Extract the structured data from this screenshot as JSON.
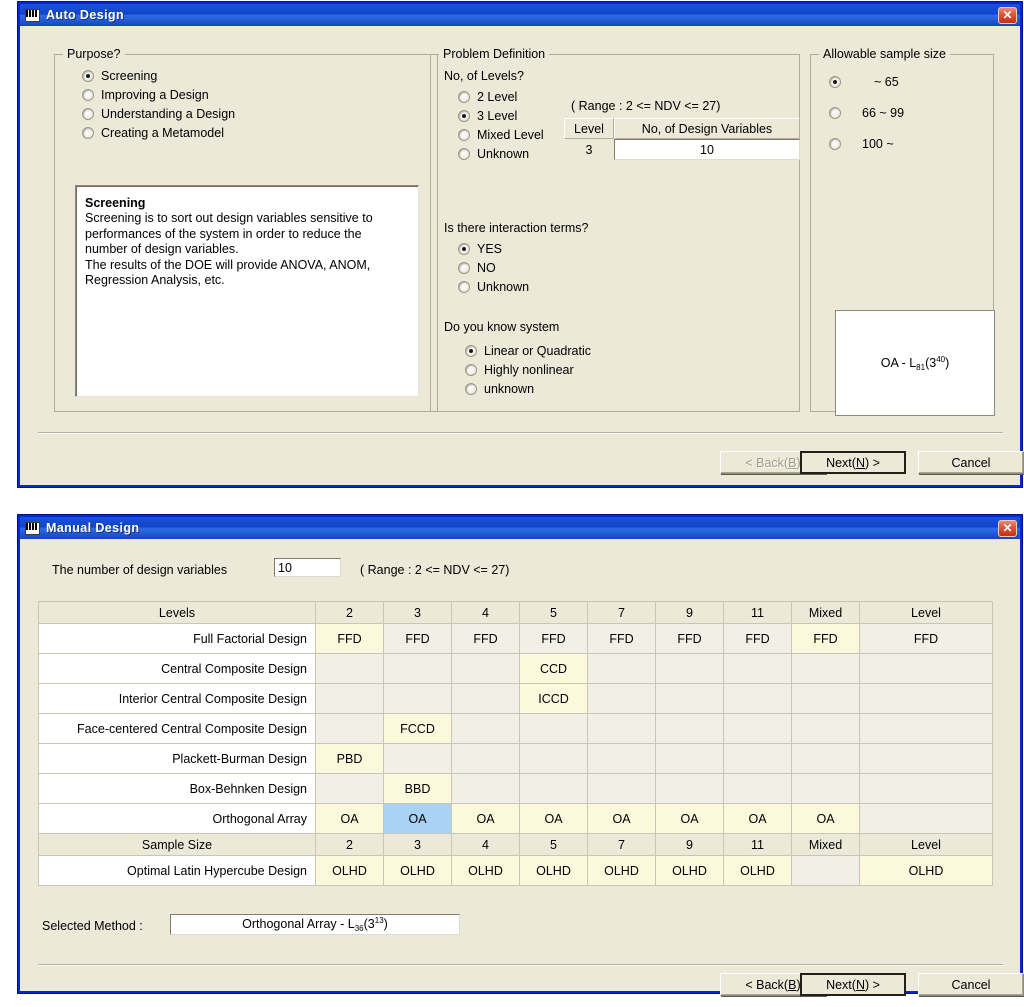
{
  "auto_design": {
    "title": "Auto Design",
    "close_label": "✕",
    "purpose": {
      "legend": "Purpose?",
      "options": [
        {
          "label": "Screening",
          "selected": true
        },
        {
          "label": "Improving a Design",
          "selected": false
        },
        {
          "label": "Understanding a Design",
          "selected": false
        },
        {
          "label": "Creating a Metamodel",
          "selected": false
        }
      ],
      "description_title": "Screening",
      "description_lines": [
        "Screening is to sort out design variables sensitive to",
        "performances of the system in order to reduce the",
        "number of design variables.",
        "The results of the DOE will provide ANOVA, ANOM,",
        "Regression Analysis, etc."
      ]
    },
    "problem_definition": {
      "legend": "Problem Definition",
      "levels_label": "No, of Levels?",
      "level_options": [
        {
          "label": "2 Level",
          "selected": false
        },
        {
          "label": "3 Level",
          "selected": true
        },
        {
          "label": "Mixed Level",
          "selected": false
        },
        {
          "label": "Unknown",
          "selected": false
        }
      ],
      "range_note": "( Range : 2 <= NDV <= 27)",
      "level_col_header": "Level",
      "ndv_col_header": "No, of Design Variables",
      "level_value": "3",
      "ndv_value": "10",
      "interaction_label": "Is there interaction terms?",
      "interaction_options": [
        {
          "label": "YES",
          "selected": true
        },
        {
          "label": "NO",
          "selected": false
        },
        {
          "label": "Unknown",
          "selected": false
        }
      ],
      "system_label": "Do you know system",
      "system_options": [
        {
          "label": "Linear or Quadratic",
          "selected": true
        },
        {
          "label": "Highly nonlinear",
          "selected": false
        },
        {
          "label": "unknown",
          "selected": false
        }
      ]
    },
    "sample_size": {
      "legend": "Allowable sample size",
      "options": [
        {
          "label": "~ 65",
          "selected": true
        },
        {
          "label": "66 ~ 99",
          "selected": false
        },
        {
          "label": "100 ~",
          "selected": false
        }
      ],
      "result_prefix": "OA - L",
      "result_sub": "81",
      "result_mid": "(3",
      "result_sup": "40",
      "result_suffix": ")"
    },
    "buttons": {
      "back": "< Back(B)",
      "back_pre": "< Back(",
      "back_key": "B",
      "back_post": ")",
      "next_pre": "Next(",
      "next_key": "N",
      "next_post": ") >",
      "cancel": "Cancel"
    }
  },
  "manual_design": {
    "title": "Manual Design",
    "close_label": "✕",
    "ndv_label": "The number of design variables",
    "ndv_value": "10",
    "range_note": "( Range : 2 <= NDV <= 27)",
    "table": {
      "corner_header": "Levels",
      "columns": [
        "2",
        "3",
        "4",
        "5",
        "7",
        "9",
        "11",
        "Mixed",
        "Level"
      ],
      "midheader": {
        "label": "Sample Size",
        "columns": [
          "2",
          "3",
          "4",
          "5",
          "7",
          "9",
          "11",
          "Mixed",
          "Level"
        ]
      },
      "rows": [
        {
          "label": "Full Factorial Design",
          "cells": [
            "FFD",
            "FFD",
            "FFD",
            "FFD",
            "FFD",
            "FFD",
            "FFD",
            "FFD",
            "FFD"
          ],
          "hi": [
            true,
            false,
            false,
            false,
            false,
            false,
            false,
            true,
            false
          ],
          "sel": [
            false,
            false,
            false,
            false,
            false,
            false,
            false,
            false,
            false
          ]
        },
        {
          "label": "Central Composite Design",
          "cells": [
            "",
            "",
            "",
            "CCD",
            "",
            "",
            "",
            "",
            ""
          ],
          "hi": [
            false,
            false,
            false,
            true,
            false,
            false,
            false,
            false,
            false
          ],
          "sel": [
            false,
            false,
            false,
            false,
            false,
            false,
            false,
            false,
            false
          ]
        },
        {
          "label": "Interior Central Composite Design",
          "cells": [
            "",
            "",
            "",
            "ICCD",
            "",
            "",
            "",
            "",
            ""
          ],
          "hi": [
            false,
            false,
            false,
            true,
            false,
            false,
            false,
            false,
            false
          ],
          "sel": [
            false,
            false,
            false,
            false,
            false,
            false,
            false,
            false,
            false
          ]
        },
        {
          "label": "Face-centered Central Composite Design",
          "cells": [
            "",
            "FCCD",
            "",
            "",
            "",
            "",
            "",
            "",
            ""
          ],
          "hi": [
            false,
            true,
            false,
            false,
            false,
            false,
            false,
            false,
            false
          ],
          "sel": [
            false,
            false,
            false,
            false,
            false,
            false,
            false,
            false,
            false
          ]
        },
        {
          "label": "Plackett-Burman Design",
          "cells": [
            "PBD",
            "",
            "",
            "",
            "",
            "",
            "",
            "",
            ""
          ],
          "hi": [
            true,
            false,
            false,
            false,
            false,
            false,
            false,
            false,
            false
          ],
          "sel": [
            false,
            false,
            false,
            false,
            false,
            false,
            false,
            false,
            false
          ]
        },
        {
          "label": "Box-Behnken Design",
          "cells": [
            "",
            "BBD",
            "",
            "",
            "",
            "",
            "",
            "",
            ""
          ],
          "hi": [
            false,
            true,
            false,
            false,
            false,
            false,
            false,
            false,
            false
          ],
          "sel": [
            false,
            false,
            false,
            false,
            false,
            false,
            false,
            false,
            false
          ]
        },
        {
          "label": "Orthogonal Array",
          "cells": [
            "OA",
            "OA",
            "OA",
            "OA",
            "OA",
            "OA",
            "OA",
            "OA",
            ""
          ],
          "hi": [
            true,
            false,
            true,
            true,
            true,
            true,
            true,
            true,
            false
          ],
          "sel": [
            false,
            true,
            false,
            false,
            false,
            false,
            false,
            false,
            false
          ]
        },
        {
          "label": "Optimal Latin Hypercube Design",
          "cells": [
            "OLHD",
            "OLHD",
            "OLHD",
            "OLHD",
            "OLHD",
            "OLHD",
            "OLHD",
            "",
            "OLHD"
          ],
          "hi": [
            true,
            true,
            true,
            true,
            true,
            true,
            true,
            false,
            true
          ],
          "sel": [
            false,
            false,
            false,
            false,
            false,
            false,
            false,
            false,
            false
          ]
        }
      ]
    },
    "selected_method_label": "Selected Method :",
    "selected_method": {
      "prefix": "Orthogonal Array - L",
      "sub": "36",
      "mid": "(3",
      "sup": "13",
      "suffix": ")"
    },
    "buttons": {
      "back_pre": "< Back(",
      "back_key": "B",
      "back_post": ")",
      "next_pre": "Next(",
      "next_key": "N",
      "next_post": ") >",
      "cancel": "Cancel"
    }
  }
}
